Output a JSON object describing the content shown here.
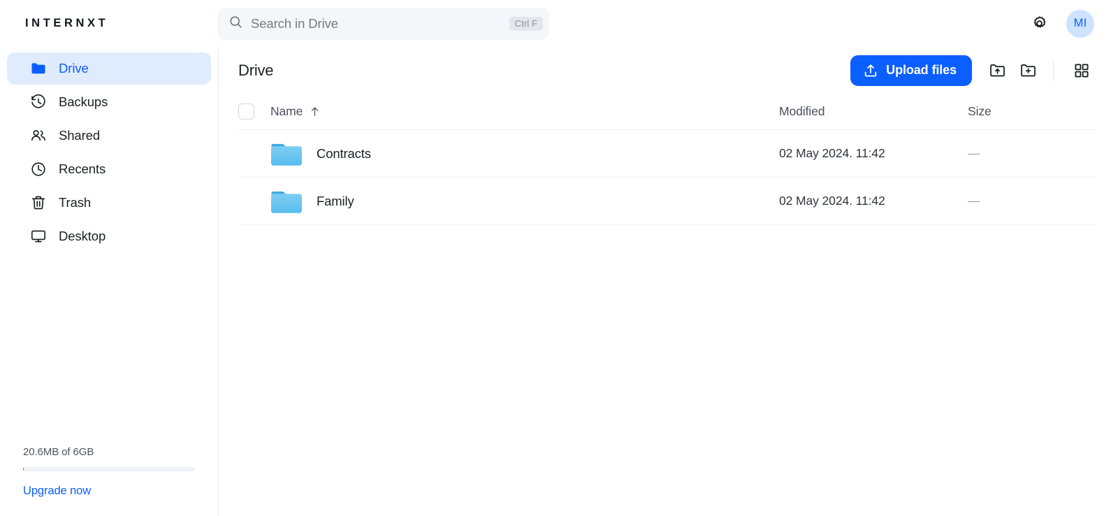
{
  "app": {
    "brand": "INTERNXT",
    "accent_color": "#0b5fff",
    "accent_soft_color": "#e0ebfd",
    "folder_color": "#63c2f0"
  },
  "search": {
    "placeholder": "Search in Drive",
    "value": "",
    "shortcut": "Ctrl F",
    "icon": "search-icon"
  },
  "topbar": {
    "settings_icon": "gear-icon",
    "avatar_initials": "MI"
  },
  "sidebar": {
    "items": [
      {
        "label": "Drive",
        "icon": "folder-icon",
        "active": true
      },
      {
        "label": "Backups",
        "icon": "clock-arrow-icon",
        "active": false
      },
      {
        "label": "Shared",
        "icon": "users-icon",
        "active": false
      },
      {
        "label": "Recents",
        "icon": "clock-icon",
        "active": false
      },
      {
        "label": "Trash",
        "icon": "trash-icon",
        "active": false
      },
      {
        "label": "Desktop",
        "icon": "monitor-icon",
        "active": false
      }
    ],
    "storage": {
      "text": "20.6MB of 6GB",
      "used_percent": 0.34,
      "upgrade_label": "Upgrade now"
    }
  },
  "main": {
    "title": "Drive",
    "toolbar": {
      "upload_label": "Upload files",
      "upload_icon": "upload-icon",
      "upload_folder_icon": "folder-upload-icon",
      "new_folder_icon": "folder-plus-icon",
      "grid_view_icon": "grid-view-icon"
    },
    "table": {
      "columns": {
        "name": "Name",
        "modified": "Modified",
        "size": "Size"
      },
      "sort": {
        "column": "Name",
        "direction": "asc",
        "icon": "arrow-up-icon"
      },
      "select_all_checked": false,
      "rows": [
        {
          "name": "Contracts",
          "icon": "folder-icon",
          "modified": "02 May 2024. 11:42",
          "size": "—"
        },
        {
          "name": "Family",
          "icon": "folder-icon",
          "modified": "02 May 2024. 11:42",
          "size": "—"
        }
      ]
    }
  }
}
